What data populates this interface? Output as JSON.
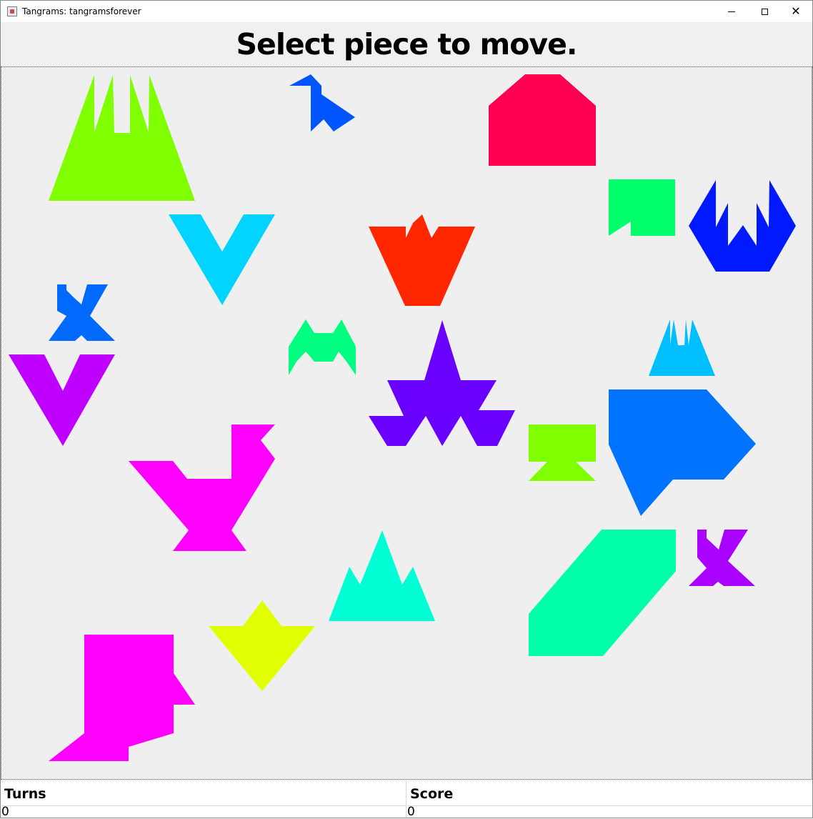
{
  "window": {
    "title": "Tangrams: tangramsforever",
    "minimize_icon": "minimize-icon",
    "maximize_icon": "maximize-icon",
    "close_icon": "close-icon"
  },
  "header": {
    "message": "Select piece to move."
  },
  "pieces": [
    {
      "name": "piece-lime-crown",
      "color": "#80ff00"
    },
    {
      "name": "piece-blue-bird",
      "color": "#0055ff"
    },
    {
      "name": "piece-crimson-house",
      "color": "#ff0050"
    },
    {
      "name": "piece-green-arrow",
      "color": "#00ff6a"
    },
    {
      "name": "piece-darkblue-hexcrown",
      "color": "#0019ff"
    },
    {
      "name": "piece-cyan-v",
      "color": "#00d4ff"
    },
    {
      "name": "piece-red-cup",
      "color": "#ff2600"
    },
    {
      "name": "piece-blue-runner",
      "color": "#006aff"
    },
    {
      "name": "piece-green-m",
      "color": "#00ff80"
    },
    {
      "name": "piece-skyblue-crown",
      "color": "#00bfff"
    },
    {
      "name": "piece-purple-v",
      "color": "#bf00ff"
    },
    {
      "name": "piece-indigo-star",
      "color": "#6a00ff"
    },
    {
      "name": "piece-lime-table",
      "color": "#80ff00"
    },
    {
      "name": "piece-azure-blob",
      "color": "#0073ff"
    },
    {
      "name": "piece-magenta-swan",
      "color": "#ff00ff"
    },
    {
      "name": "piece-teal-mountain",
      "color": "#00ffd4"
    },
    {
      "name": "piece-mint-slab",
      "color": "#00ffaa"
    },
    {
      "name": "piece-violet-runner",
      "color": "#aa00ff"
    },
    {
      "name": "piece-yellow-kite",
      "color": "#e0ff00"
    },
    {
      "name": "piece-magenta-boot",
      "color": "#ff00ff"
    }
  ],
  "status": {
    "turns_label": "Turns",
    "turns_value": "0",
    "score_label": "Score",
    "score_value": "0"
  }
}
